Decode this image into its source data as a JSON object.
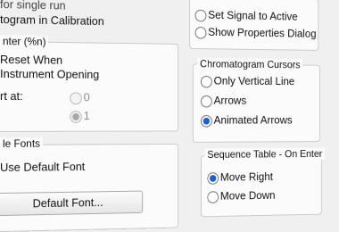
{
  "top_left": {
    "line1": "for single run",
    "line2": "togram in Calibration"
  },
  "enter_group": {
    "legend": "nter (%n)",
    "reset_line1": "Reset When",
    "reset_line2": "Instrument Opening",
    "start_label": "rt at:",
    "option_0": "0",
    "option_1": "1"
  },
  "fonts_group": {
    "legend": "le Fonts",
    "use_default_label": "Use Default Font",
    "default_font_button": "Default Font..."
  },
  "right_top": {
    "set_signal_label": "Set Signal to Active",
    "show_properties_label": "Show Properties Dialog"
  },
  "cursors_group": {
    "legend": "Chromatogram Cursors",
    "options": [
      "Only Vertical Line",
      "Arrows",
      "Animated Arrows"
    ],
    "selected": "Animated Arrows"
  },
  "sequence_group": {
    "legend": "Sequence Table - On Enter",
    "options": [
      "Move Right",
      "Move Down"
    ],
    "selected": "Move Right"
  }
}
